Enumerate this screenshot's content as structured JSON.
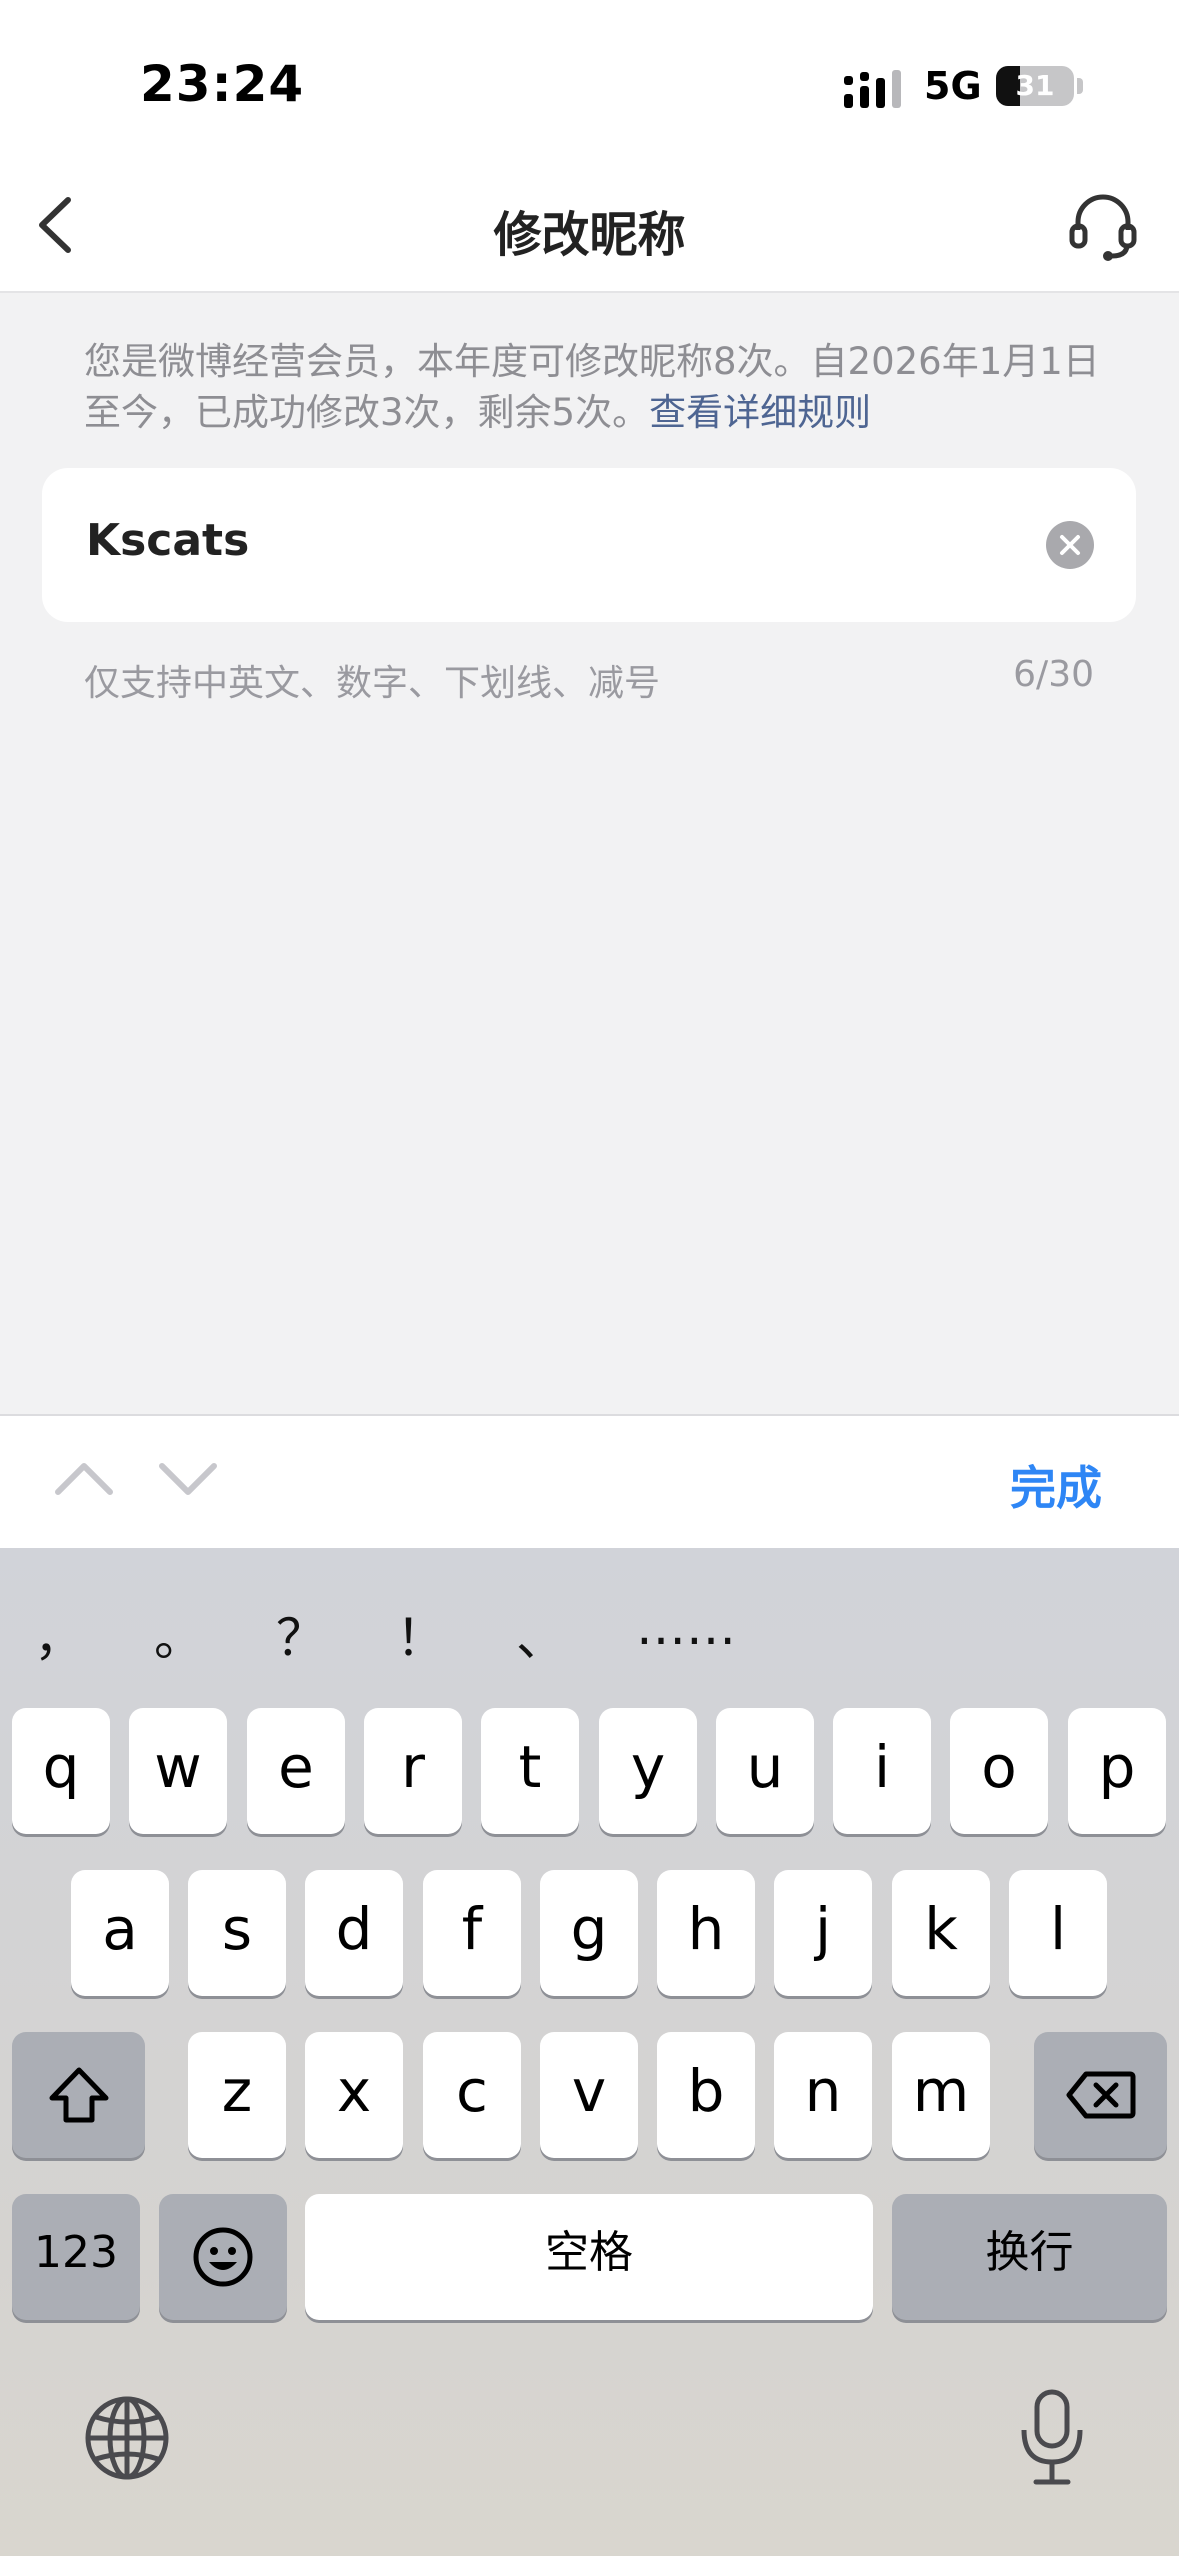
{
  "status_bar": {
    "time": "23:24",
    "network": "5G",
    "battery_level": 31
  },
  "header": {
    "title": "修改昵称",
    "back_icon": "chevron-left-icon",
    "service_icon": "headset-icon"
  },
  "notice": {
    "text": "您是微博经营会员，本年度可修改昵称8次。自2026年1月1日至今，已成功修改3次，剩余5次。",
    "link": "查看详细规则"
  },
  "nickname_input": {
    "value": "Kscats",
    "clear_icon": "clear-circle-icon"
  },
  "hint": {
    "text": "仅支持中英文、数字、下划线、减号",
    "counter": "6/30"
  },
  "toolbar": {
    "prev_icon": "chevron-up-icon",
    "next_icon": "chevron-down-icon",
    "done_label": "完成"
  },
  "keyboard": {
    "punctuation": [
      "，",
      "。",
      "？",
      "！",
      "、",
      "……"
    ],
    "row1": [
      "q",
      "w",
      "e",
      "r",
      "t",
      "y",
      "u",
      "i",
      "o",
      "p"
    ],
    "row2": [
      "a",
      "s",
      "d",
      "f",
      "g",
      "h",
      "j",
      "k",
      "l"
    ],
    "row3": [
      "z",
      "x",
      "c",
      "v",
      "b",
      "n",
      "m"
    ],
    "numbers_label": "123",
    "space_label": "空格",
    "return_label": "换行",
    "shift_icon": "shift-icon",
    "delete_icon": "delete-icon",
    "emoji_icon": "emoji-icon",
    "globe_icon": "globe-icon",
    "mic_icon": "microphone-icon"
  },
  "colors": {
    "link": "#4e6592",
    "accent": "#2e86f5",
    "page_background": "#f2f2f3"
  }
}
